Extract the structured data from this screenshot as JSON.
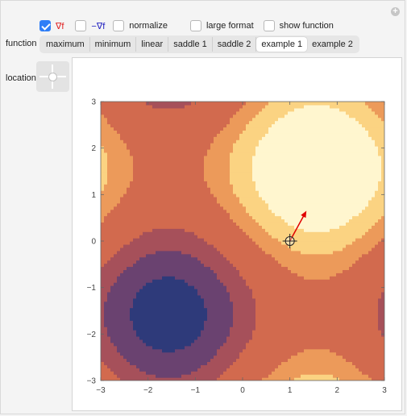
{
  "controls": {
    "grad_label": "∇f",
    "neg_grad_label": "−∇f",
    "normalize_label": "normalize",
    "large_format_label": "large format",
    "show_function_label": "show function",
    "grad_checked": true,
    "neg_grad_checked": false,
    "normalize_checked": false,
    "large_format_checked": false,
    "show_function_checked": false
  },
  "function": {
    "label": "function",
    "options": [
      "maximum",
      "minimum",
      "linear",
      "saddle 1",
      "saddle 2",
      "example 1",
      "example 2"
    ],
    "selected": "example 1"
  },
  "location": {
    "label": "location"
  },
  "chart_data": {
    "type": "contour",
    "function_shown": "example 1",
    "xlim": [
      -3,
      3
    ],
    "ylim": [
      -3,
      3
    ],
    "x_ticks": [
      "−3",
      "−2",
      "−1",
      "0",
      "1",
      "2",
      "3"
    ],
    "y_ticks": [
      "−3",
      "−2",
      "−1",
      "0",
      "1",
      "2",
      "3"
    ],
    "point": [
      1,
      0
    ],
    "gradient_vector_end": [
      1.35,
      0.65
    ],
    "colors": {
      "lowest": "#2e3a7a",
      "low": "#6a4270",
      "mid_low": "#a6505a",
      "mid": "#d26a4e",
      "mid_high": "#ec9a5a",
      "high": "#fbd382",
      "highest": "#fff6cf",
      "gradient_arrow": "#e00000"
    }
  }
}
